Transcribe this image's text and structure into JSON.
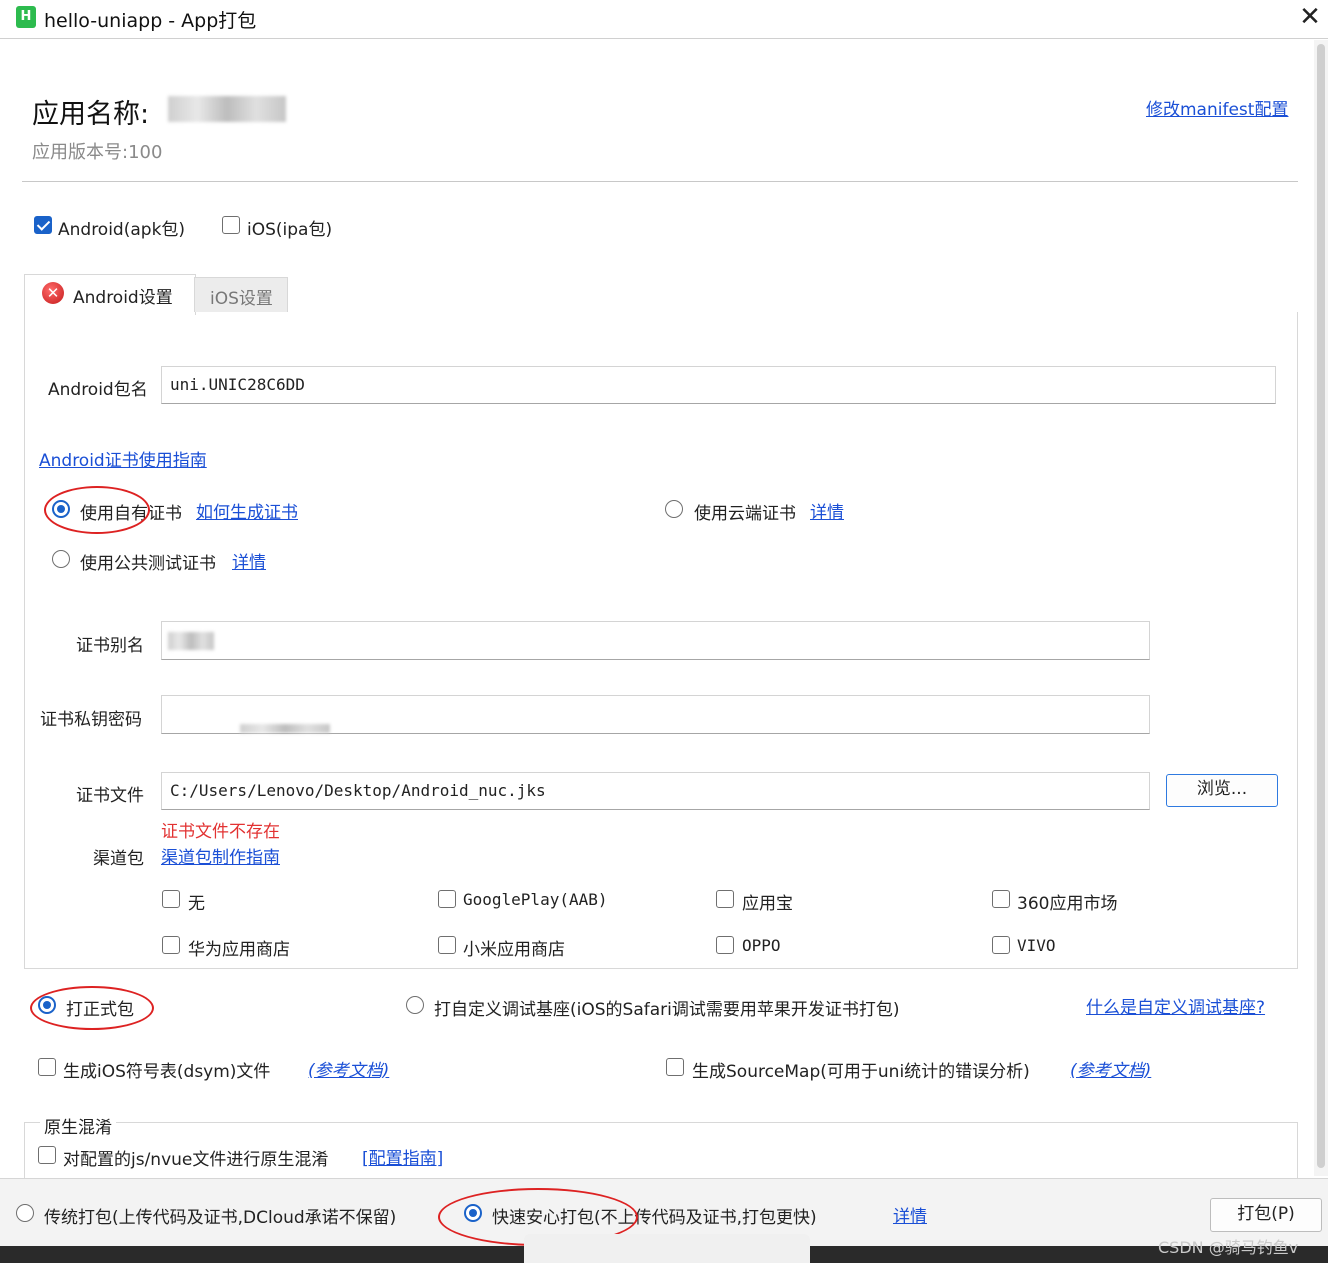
{
  "window": {
    "icon_letter": "H",
    "title": "hello-uniapp - App打包",
    "close_glyph": "✕"
  },
  "header": {
    "app_name_label": "应用名称:",
    "version_label": "应用版本号:100",
    "manifest_link": "修改manifest配置"
  },
  "platforms": {
    "android": {
      "label": "Android(apk包)",
      "checked": true
    },
    "ios": {
      "label": "iOS(ipa包)",
      "checked": false
    }
  },
  "tabs": [
    {
      "label": "Android设置",
      "active": true,
      "status_icon": "error-icon"
    },
    {
      "label": "iOS设置",
      "active": false
    }
  ],
  "android": {
    "package_label": "Android包名",
    "package_value": "uni.UNIC28C6DD",
    "cert_guide_link": "Android证书使用指南",
    "cert_options": [
      {
        "label": "使用自有证书",
        "link": "如何生成证书",
        "selected": true
      },
      {
        "label": "使用云端证书",
        "link": "详情",
        "selected": false
      },
      {
        "label": "使用公共测试证书",
        "link": "详情",
        "selected": false
      }
    ],
    "alias_label": "证书别名",
    "password_label": "证书私钥密码",
    "file_label": "证书文件",
    "file_value": "C:/Users/Lenovo/Desktop/Android_nuc.jks",
    "browse_label": "浏览...",
    "file_error": "证书文件不存在",
    "channel_label": "渠道包",
    "channel_link": "渠道包制作指南",
    "channels": [
      {
        "label": "无",
        "checked": false
      },
      {
        "label": "GooglePlay(AAB)",
        "checked": false
      },
      {
        "label": "应用宝",
        "checked": false
      },
      {
        "label": "360应用市场",
        "checked": false
      },
      {
        "label": "华为应用商店",
        "checked": false
      },
      {
        "label": "小米应用商店",
        "checked": false
      },
      {
        "label": "OPPO",
        "checked": false
      },
      {
        "label": "VIVO",
        "checked": false
      }
    ]
  },
  "build_type": {
    "release_label": "打正式包",
    "release_selected": true,
    "custom_base_label": "打自定义调试基座(iOS的Safari调试需要用苹果开发证书打包)",
    "custom_base_selected": false,
    "custom_base_link": "什么是自定义调试基座?"
  },
  "options": {
    "dsym_label": "生成iOS符号表(dsym)文件",
    "dsym_link": "(参考文档)",
    "sourcemap_label": "生成SourceMap(可用于uni统计的错误分析)",
    "sourcemap_link": "(参考文档)"
  },
  "obfuscation": {
    "group_title": "原生混淆",
    "label": "对配置的js/nvue文件进行原生混淆",
    "link": "[配置指南]"
  },
  "footer": {
    "traditional_label": "传统打包(上传代码及证书,DCloud承诺不保留)",
    "traditional_selected": false,
    "fast_label": "快速安心打包(不上传代码及证书,打包更快)",
    "fast_selected": true,
    "fast_link": "详情",
    "pack_button": "打包(P)"
  },
  "watermark": "CSDN @骑马钓鱼v",
  "colors": {
    "accent": "#1a62c9",
    "link": "#1a4fd6",
    "error": "#e23232",
    "annotation": "#dd2222"
  }
}
